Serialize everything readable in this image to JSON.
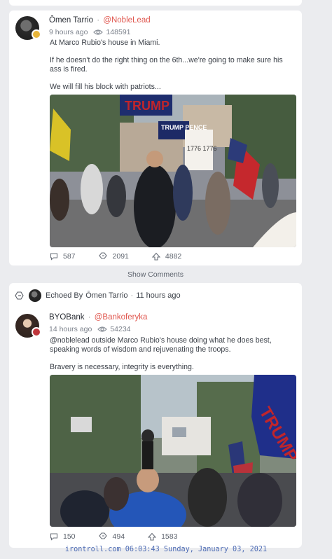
{
  "post1": {
    "display_name": "Ōmen Tarrio",
    "handle": "@NobleLead",
    "time_ago": "9 hours ago",
    "views": "148591",
    "text": [
      "At Marco Rubio's house in Miami.",
      "If he doesn't do the right thing on the 6th...we're going to make sure his ass is fired.",
      "We will fill his block with patriots..."
    ],
    "photo_signs": [
      "TRUMP",
      "TRUMP PENCE",
      "1776 1776"
    ],
    "comments": "587",
    "echoes": "2091",
    "upvotes": "4882"
  },
  "show_comments": "Show Comments",
  "echo": {
    "prefix": "Echoed By",
    "name": "Ōmen Tarrio",
    "separator": "·",
    "time_ago": "11 hours ago"
  },
  "post2": {
    "display_name": "BYOBank",
    "handle": "@Bankoferyka",
    "time_ago": "14 hours ago",
    "views": "54234",
    "text": [
      "@noblelead outside Marco Rubio's house doing what he does best, speaking words of wisdom and rejuvenating the troops.",
      "Bravery is necessary, integrity is everything."
    ],
    "photo_signs": [
      "TRUMP"
    ],
    "comments": "150",
    "echoes": "494",
    "upvotes": "1583"
  },
  "footer": "irontroll.com 06:03:43 Sunday, January 03, 2021",
  "colors": {
    "handle": "#e0574f",
    "footer": "#4f6db5",
    "background": "#ebecef"
  },
  "icons": [
    "eye-icon",
    "comment-icon",
    "echo-icon",
    "upvote-icon"
  ]
}
